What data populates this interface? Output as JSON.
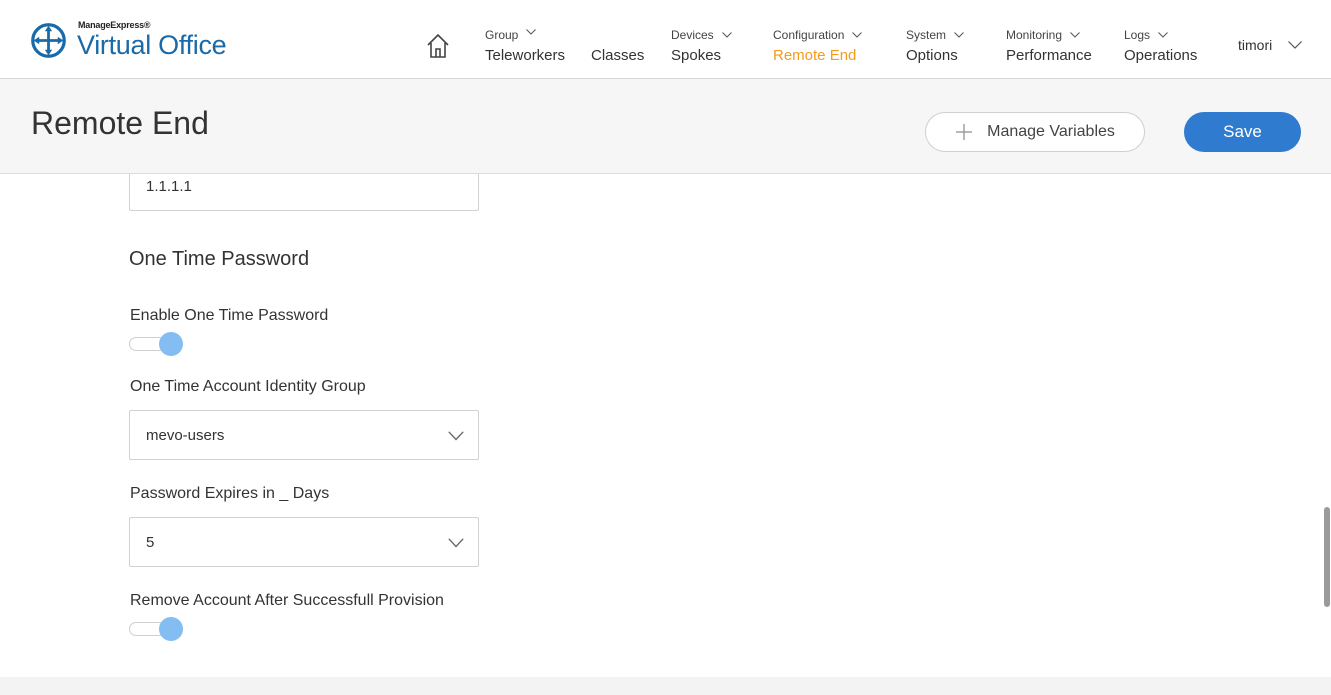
{
  "logo": {
    "small_text": "ManageExpress®",
    "big_text": "Virtual Office",
    "icon": "compass-crosshair-icon"
  },
  "nav": {
    "home_icon": "home-icon",
    "items": [
      {
        "top": "Group",
        "bottom": "Teleworkers"
      },
      {
        "top": "",
        "bottom": "Classes"
      },
      {
        "top": "Devices",
        "bottom": "Spokes"
      },
      {
        "top": "Configuration",
        "bottom": "Remote End"
      },
      {
        "top": "System",
        "bottom": "Options"
      },
      {
        "top": "Monitoring",
        "bottom": "Performance"
      },
      {
        "top": "Logs",
        "bottom": "Operations"
      }
    ],
    "user": "timori"
  },
  "header": {
    "title": "Remote End",
    "manage_variables_label": "Manage Variables",
    "save_label": "Save"
  },
  "form": {
    "ip_value": "1.1.1.1",
    "section_title": "One Time Password",
    "enable_otp_label": "Enable One Time Password",
    "enable_otp_on": true,
    "identity_group_label": "One Time Account Identity Group",
    "identity_group_value": "mevo-users",
    "expires_label": "Password Expires in _ Days",
    "expires_value": "5",
    "remove_account_label": "Remove Account After Successfull Provision",
    "remove_account_on": true
  },
  "colors": {
    "accent": "#2f7bd0",
    "active_nav": "#f59a1c",
    "toggle_on": "#84bdf2",
    "brand": "#1b6aa8"
  }
}
